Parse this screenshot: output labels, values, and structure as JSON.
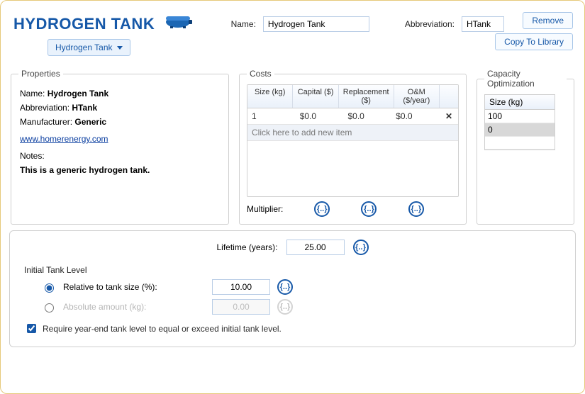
{
  "title": "HYDROGEN TANK",
  "dropdown_label": "Hydrogen Tank",
  "name_label": "Name:",
  "name_value": "Hydrogen Tank",
  "abbr_label": "Abbreviation:",
  "abbr_value": "HTank",
  "buttons": {
    "remove": "Remove",
    "copy": "Copy To Library"
  },
  "props": {
    "legend": "Properties",
    "name_label": "Name:",
    "name_value": "Hydrogen Tank",
    "abbr_label": "Abbreviation:",
    "abbr_value": "HTank",
    "manu_label": "Manufacturer:",
    "manu_value": "Generic",
    "link": "www.homerenergy.com",
    "notes_label": "Notes:",
    "notes_value": "This is a generic hydrogen tank."
  },
  "costs": {
    "legend": "Costs",
    "headers": {
      "size": "Size (kg)",
      "capital": "Capital ($)",
      "replace": "Replacement ($)",
      "om": "O&M ($/year)"
    },
    "rows": [
      {
        "size": "1",
        "capital": "$0.0",
        "replace": "$0.0",
        "om": "$0.0"
      }
    ],
    "add_prompt": "Click here to add new item",
    "multiplier_label": "Multiplier:"
  },
  "capopt": {
    "legend": "Capacity Optimization",
    "header": "Size (kg)",
    "values": [
      "100",
      "0",
      ""
    ]
  },
  "lifetime": {
    "label": "Lifetime (years):",
    "value": "25.00"
  },
  "itl": {
    "legend": "Initial Tank Level",
    "relative_label": "Relative to tank size (%):",
    "relative_value": "10.00",
    "absolute_label": "Absolute amount (kg):",
    "absolute_value": "0.00"
  },
  "require_label": "Require year-end tank level to equal or exceed initial tank level.",
  "dots": "{..}"
}
